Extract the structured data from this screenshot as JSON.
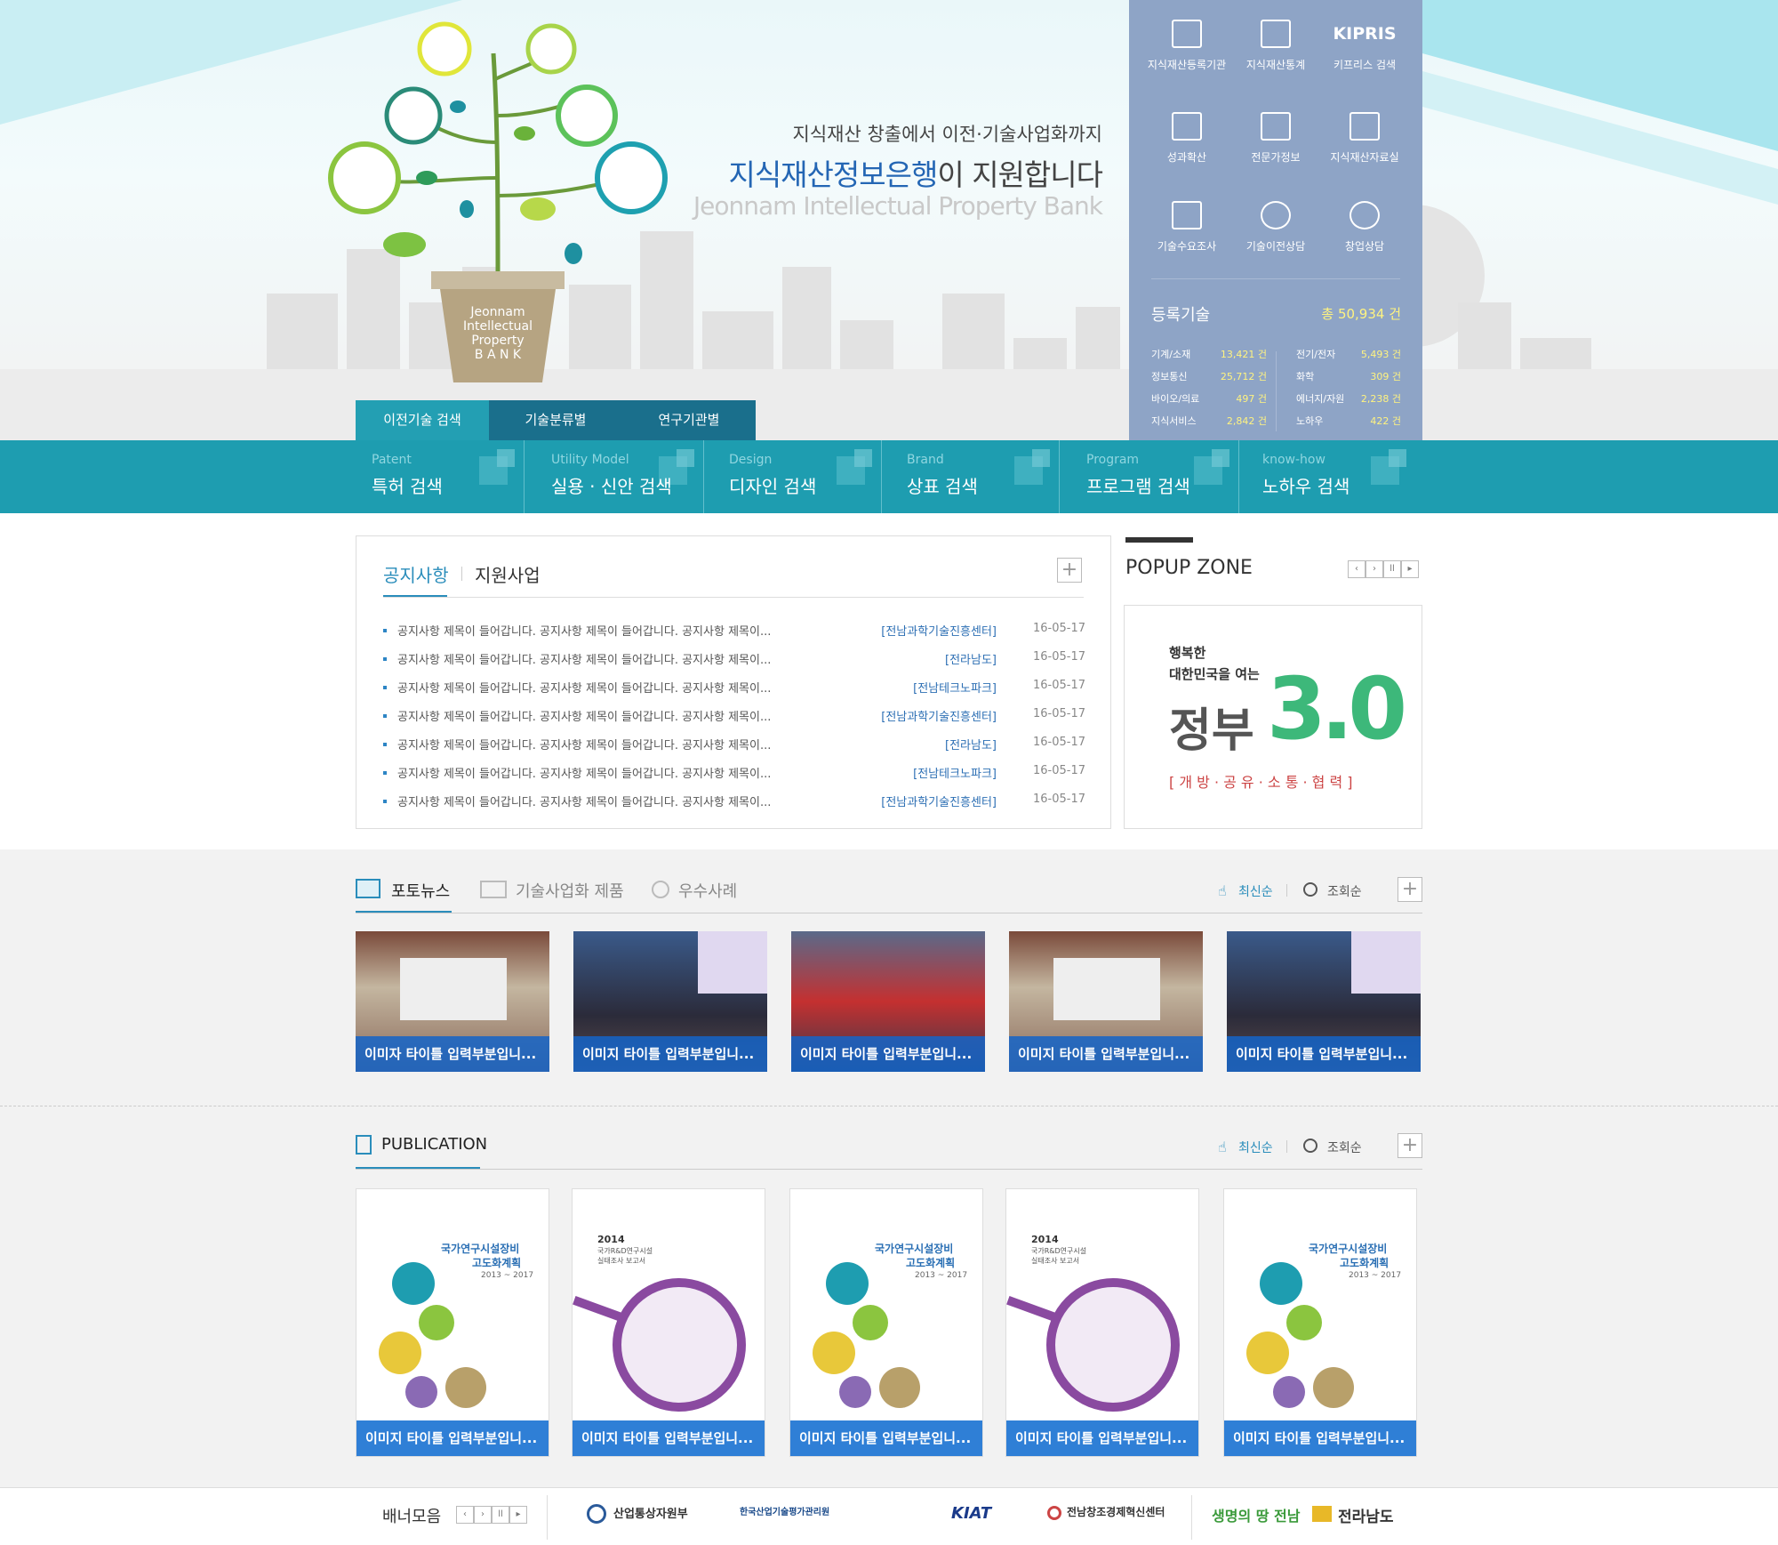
{
  "hero": {
    "tagline": "지식재산 창출에서 이전·기술사업화까지",
    "headline_highlight": "지식재산정보은행",
    "headline_rest": "이 지원합니다",
    "english_title": "Jeonnam Intellectual Property Bank",
    "pot_text": [
      "Jeonnam",
      "Intellectual",
      "Property",
      "B A N K"
    ]
  },
  "quick_links": [
    "지식재산등록기관",
    "지식재산통계",
    "키프리스 검색",
    "성과확산",
    "전문가정보",
    "지식재산자료실",
    "기술수요조사",
    "기술이전상담",
    "창업상담"
  ],
  "kipris_label": "KIPRIS",
  "registered": {
    "title": "등록기술",
    "total": "총 50,934 건",
    "rows": [
      {
        "label": "기계/소재",
        "value": "13,421 건"
      },
      {
        "label": "전기/전자",
        "value": "5,493 건"
      },
      {
        "label": "정보통신",
        "value": "25,712 건"
      },
      {
        "label": "화학",
        "value": "309 건"
      },
      {
        "label": "바이오/의료",
        "value": "497 건"
      },
      {
        "label": "에너지/자원",
        "value": "2,238 건"
      },
      {
        "label": "지식서비스",
        "value": "2,842 건"
      },
      {
        "label": "노하우",
        "value": "422 건"
      }
    ]
  },
  "search_tabs": [
    "이전기술 검색",
    "기술분류별",
    "연구기관별"
  ],
  "search_items": [
    {
      "en": "Patent",
      "ko": "특허 검색"
    },
    {
      "en": "Utility Model",
      "ko": "실용 · 신안 검색"
    },
    {
      "en": "Design",
      "ko": "디자인 검색"
    },
    {
      "en": "Brand",
      "ko": "상표 검색"
    },
    {
      "en": "Program",
      "ko": "프로그램 검색"
    },
    {
      "en": "know-how",
      "ko": "노하우 검색"
    }
  ],
  "notice": {
    "tabs": [
      "공지사항",
      "지원사업"
    ],
    "rows": [
      {
        "title": "공지사항 제목이 들어갑니다. 공지사항 제목이 들어갑니다. 공지사항 제목이...",
        "org": "[전남과학기술진흥센터]",
        "date": "16-05-17"
      },
      {
        "title": "공지사항 제목이 들어갑니다.  공지사항 제목이 들어갑니다. 공지사항 제목이...",
        "org": "[전라남도]",
        "date": "16-05-17"
      },
      {
        "title": "공지사항 제목이 들어갑니다. 공지사항 제목이 들어갑니다. 공지사항 제목이...",
        "org": "[전남테크노파크]",
        "date": "16-05-17"
      },
      {
        "title": "공지사항 제목이 들어갑니다. 공지사항 제목이 들어갑니다. 공지사항 제목이...",
        "org": "[전남과학기술진흥센터]",
        "date": "16-05-17"
      },
      {
        "title": "공지사항 제목이 들어갑니다. 공지사항 제목이 들어갑니다. 공지사항 제목이...",
        "org": "[전라남도]",
        "date": "16-05-17"
      },
      {
        "title": "공지사항 제목이 들어갑니다. 공지사항 제목이 들어갑니다. 공지사항 제목이...",
        "org": "[전남테크노파크]",
        "date": "16-05-17"
      },
      {
        "title": "공지사항 제목이 들어갑니다. 공지사항 제목이 들어갑니다. 공지사항 제목이...",
        "org": "[전남과학기술진흥센터]",
        "date": "16-05-17"
      }
    ]
  },
  "popup": {
    "title": "POPUP ZONE",
    "line1": "행복한",
    "line2": "대한민국을 여는",
    "gov": "정부",
    "ver": "3.0",
    "slogan": "[ 개 방 · 공 유 · 소 통 · 협 력 ]"
  },
  "photo_section": {
    "tabs": [
      "포토뉴스",
      "기술사업화 제품",
      "우수사례"
    ],
    "sort_latest": "최신순",
    "sort_views": "조회순",
    "captions": [
      "이미자 타이틀 입력부분입니...",
      "이미지 타이틀 입력부분입니...",
      "이미지 타이틀 입력부분입니...",
      "이미지 타이틀 입력부분입니...",
      "이미지 타이틀 입력부분입니..."
    ]
  },
  "publication": {
    "title": "PUBLICATION",
    "sort_latest": "최신순",
    "sort_views": "조회순",
    "book_a": {
      "title1": "국가연구시설장비",
      "title2": "고도화계획",
      "years": "2013 ~ 2017"
    },
    "book_b": {
      "year": "2014",
      "sub1": "국가R&D연구시설",
      "sub2": "실태조사 보고서"
    },
    "captions": [
      "이미지 타이틀 입력부분입니...",
      "이미지 타이틀 입력부분입니...",
      "이미지 타이틀 입력부분입니...",
      "이미지 타이틀 입력부분입니...",
      "이미지 타이틀 입력부분입니..."
    ]
  },
  "footer": {
    "label": "배너모음",
    "logos": [
      "산업통상자원부",
      "한국산업기술평가관리원",
      "KIAT",
      "전남창조경제혁신센터",
      "생명의 땅 전남",
      "전라남도"
    ]
  },
  "colors": {
    "accent": "#1e9db0",
    "tab_dark": "#1a6f8c",
    "panel": "#8ea4c6",
    "link_blue": "#2466b4",
    "caption_blue": "#2f7fd6"
  }
}
